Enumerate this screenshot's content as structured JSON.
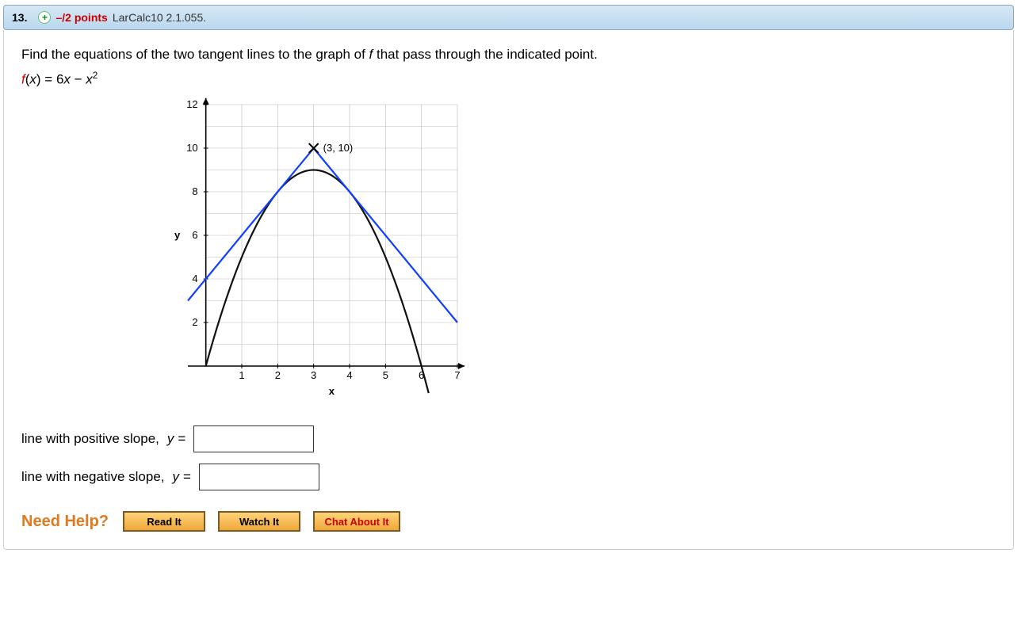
{
  "header": {
    "number": "13.",
    "plus_symbol": "+",
    "points": "–/2 points",
    "source": "LarCalc10 2.1.055."
  },
  "prompt": {
    "text_before_f": "Find the equations of the two tangent lines to the graph of ",
    "f": "f",
    "text_after_f": " that pass through the indicated point."
  },
  "function": {
    "f": "f",
    "open": "(",
    "x": "x",
    "close": ")",
    "equals": " = 6",
    "x2": "x",
    "minus": " − ",
    "x3": "x",
    "sup": "2"
  },
  "chart_data": {
    "type": "line",
    "title": "",
    "xlabel": "x",
    "ylabel": "y",
    "xlim": [
      -0.5,
      7
    ],
    "ylim": [
      0,
      12
    ],
    "x_ticks": [
      1,
      2,
      3,
      4,
      5,
      6,
      7
    ],
    "y_ticks": [
      2,
      4,
      6,
      8,
      10,
      12
    ],
    "annotations": [
      {
        "label": "(3, 10)",
        "x": 3,
        "y": 10
      }
    ],
    "series": [
      {
        "name": "parabola f(x)=6x−x^2",
        "color": "#111111",
        "x": [
          0,
          0.5,
          1,
          1.5,
          2,
          2.5,
          3,
          3.5,
          4,
          4.5,
          5,
          5.5,
          6,
          6.2
        ],
        "values": [
          0,
          2.75,
          5,
          6.75,
          8,
          8.75,
          9,
          8.75,
          8,
          6.75,
          5,
          2.75,
          0,
          -1.24
        ]
      },
      {
        "name": "tangent line positive slope y=2x+4",
        "color": "#1040ff",
        "x": [
          -0.5,
          3
        ],
        "values": [
          3,
          10
        ]
      },
      {
        "name": "tangent line negative slope y=−2x+16",
        "color": "#1040ff",
        "x": [
          3,
          7
        ],
        "values": [
          10,
          2
        ]
      }
    ]
  },
  "answers": {
    "pos_label": "line with positive slope,",
    "pos_eq": "y =",
    "pos_value": "",
    "neg_label": "line with negative slope,",
    "neg_eq": "y =",
    "neg_value": ""
  },
  "help": {
    "label": "Need Help?",
    "read": "Read It",
    "watch": "Watch It",
    "chat": "Chat About It"
  }
}
